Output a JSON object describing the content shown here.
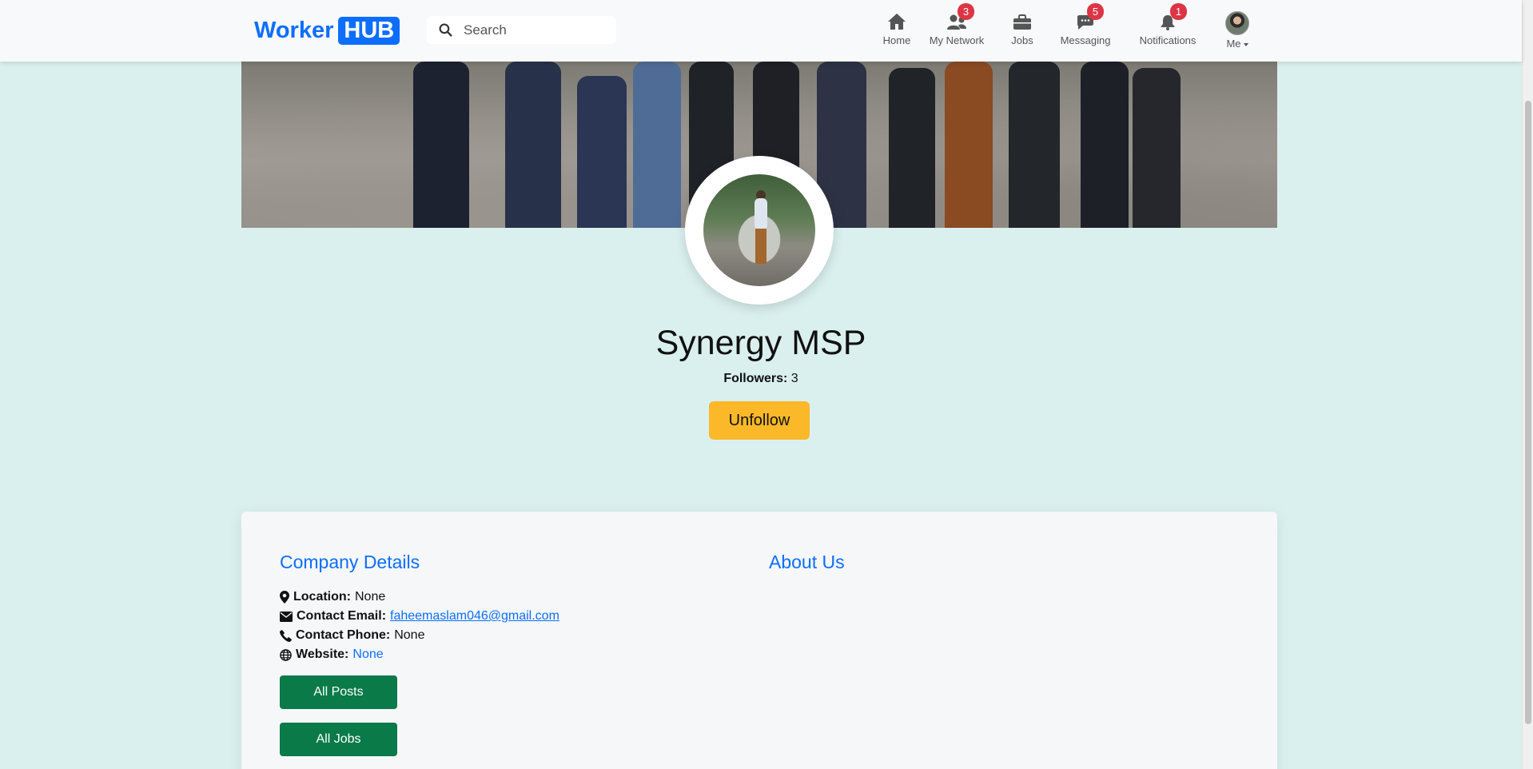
{
  "navbar": {
    "brand_word": "Worker",
    "brand_badge": "HUB",
    "search_placeholder": "Search",
    "items": [
      {
        "label": "Home",
        "icon": "home-icon",
        "badge": ""
      },
      {
        "label": "My Network",
        "icon": "network-icon",
        "badge": "3"
      },
      {
        "label": "Jobs",
        "icon": "briefcase-icon",
        "badge": ""
      },
      {
        "label": "Messaging",
        "icon": "chat-icon",
        "badge": "5"
      },
      {
        "label": "Notifications",
        "icon": "bell-icon",
        "badge": "1"
      }
    ],
    "me_label": "Me"
  },
  "profile": {
    "company_name": "Synergy MSP",
    "followers_label": "Followers:",
    "followers_count": "3",
    "unfollow_label": "Unfollow"
  },
  "details": {
    "title": "Company Details",
    "about_title": "About Us",
    "location_label": "Location:",
    "location_value": "None",
    "email_label": "Contact Email:",
    "email_value": "faheemaslam046@gmail.com",
    "phone_label": "Contact Phone:",
    "phone_value": "None",
    "website_label": "Website:",
    "website_value": "None",
    "all_posts_label": "All Posts",
    "all_jobs_label": "All Jobs"
  },
  "colors": {
    "brand_blue": "#0d6efd",
    "page_background": "#daf0ee",
    "badge_red": "#dc3545",
    "unfollow_yellow": "#fbb829",
    "button_green": "#0a7a48"
  }
}
